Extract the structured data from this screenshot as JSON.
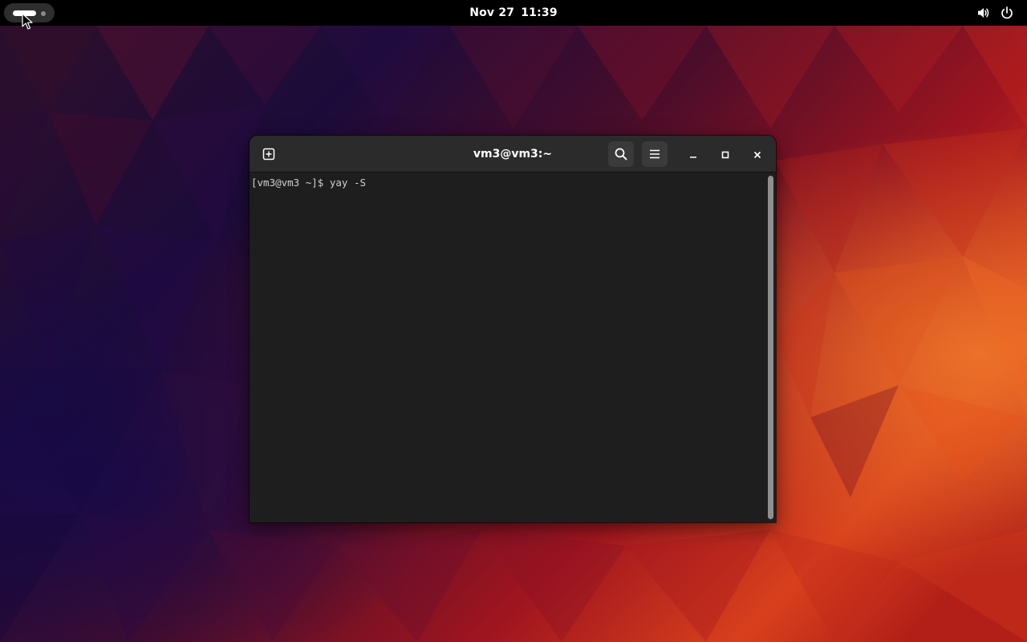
{
  "top_bar": {
    "clock_date": "Nov 27",
    "clock_time": "11:39",
    "activities_icon": "activities-pill-icon",
    "volume_icon": "volume-icon",
    "power_icon": "power-icon"
  },
  "terminal": {
    "title": "vm3@vm3:~",
    "new_tab_icon": "new-tab-icon",
    "search_icon": "search-icon",
    "menu_icon": "hamburger-menu-icon",
    "minimize_icon": "minimize-icon",
    "maximize_icon": "maximize-icon",
    "close_icon": "close-icon",
    "prompt": "[vm3@vm3 ~]$ ",
    "command": "yay -S",
    "background_color": "#1e1e1e",
    "header_color": "#2b2b2b"
  },
  "wallpaper": {
    "style": "low-poly triangles",
    "colors": [
      "#1a0a3a",
      "#5a0f2a",
      "#b01820",
      "#e8601a"
    ]
  }
}
